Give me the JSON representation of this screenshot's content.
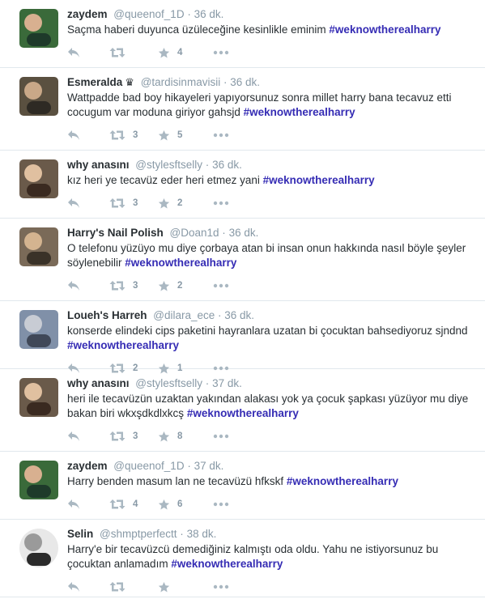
{
  "tweets": [
    {
      "name": "zaydem",
      "handle": "@queenof_1D",
      "sep": "·",
      "time": "36 dk.",
      "text": "Saçma haberi duyunca üzüleceğine kesinlikle eminim ",
      "hashtag": "#weknowtherealharry",
      "retweets": "",
      "favorites": "4",
      "avatar_colors": [
        "#3a6a3a",
        "#d8b090",
        "#1e3a2a"
      ],
      "crown": ""
    },
    {
      "name": "Esmeralda",
      "handle": "@tardisinmavisii",
      "sep": "·",
      "time": "36 dk.",
      "text": "Wattpadde bad boy hikayeleri yapıyorsunuz sonra millet harry bana tecavuz etti cocugum var moduna giriyor gahsjd ",
      "hashtag": "#weknowtherealharry",
      "retweets": "3",
      "favorites": "5",
      "avatar_colors": [
        "#5a5040",
        "#c9a888",
        "#2e2a24"
      ],
      "crown": "♛"
    },
    {
      "name": "why anasını",
      "handle": "@stylesftselly",
      "sep": "·",
      "time": "36 dk.",
      "text": "kız heri ye tecavüz eder heri etmez yani  ",
      "hashtag": "#weknowtherealharry",
      "retweets": "3",
      "favorites": "2",
      "avatar_colors": [
        "#6a5a4a",
        "#e0c0a0",
        "#3a2a20"
      ],
      "crown": ""
    },
    {
      "name": "Harry's Nail Polish",
      "handle": "@Doan1d",
      "sep": "·",
      "time": "36 dk.",
      "text": "O telefonu yüzüyo mu diye çorbaya atan bi insan onun hakkında nasıl böyle şeyler söylenebilir ",
      "hashtag": "#weknowtherealharry",
      "retweets": "3",
      "favorites": "2",
      "avatar_colors": [
        "#7a6a58",
        "#d4b490",
        "#3a3228"
      ],
      "crown": ""
    },
    {
      "name": "Loueh's Harreh",
      "handle": "@dilara_ece",
      "sep": "·",
      "time": "36 dk.",
      "text": "konserde elindeki cips paketini hayranlara uzatan bi çocuktan bahsediyoruz sjndnd ",
      "hashtag": "#weknowtherealharry",
      "retweets": "2",
      "favorites": "1",
      "avatar_colors": [
        "#8090a8",
        "#c8ccd4",
        "#404858"
      ],
      "crown": ""
    },
    {
      "name": "why anasını",
      "handle": "@stylesftselly",
      "sep": "·",
      "time": "37 dk.",
      "text": "heri ile tecavüzün uzaktan yakından alakası yok ya çocuk şapkası yüzüyor mu diye bakan biri wkxşdkdlxkcş ",
      "hashtag": "#weknowtherealharry",
      "retweets": "3",
      "favorites": "8",
      "avatar_colors": [
        "#6a5a4a",
        "#e0c0a0",
        "#3a2a20"
      ],
      "crown": ""
    },
    {
      "name": "zaydem",
      "handle": "@queenof_1D",
      "sep": "·",
      "time": "37 dk.",
      "text": "Harry benden masum lan ne tecavüzü hfkskf ",
      "hashtag": "#weknowtherealharry",
      "retweets": "4",
      "favorites": "6",
      "avatar_colors": [
        "#3a6a3a",
        "#d8b090",
        "#1e3a2a"
      ],
      "crown": ""
    },
    {
      "name": "Selin",
      "handle": "@shmptperfectt",
      "sep": "·",
      "time": "38 dk.",
      "text": "Harry'e bir tecavüzcü demediğiniz kalmıştı oda oldu. Yahu ne istiyorsunuz bu çocuktan anlamadım ",
      "hashtag": "#weknowtherealharry",
      "retweets": "",
      "favorites": "",
      "avatar_colors": [
        "#e8e8e8",
        "#9a9a9a",
        "#2a2a2a"
      ],
      "crown": "",
      "round": true
    }
  ],
  "icons": {
    "reply": "reply-icon",
    "retweet": "retweet-icon",
    "favorite": "star-icon",
    "more": "more-icon"
  },
  "colors": {
    "hashtag": "#352cb4",
    "meta": "#8899a6",
    "text": "#292f33",
    "divider": "#e1e8ed"
  }
}
